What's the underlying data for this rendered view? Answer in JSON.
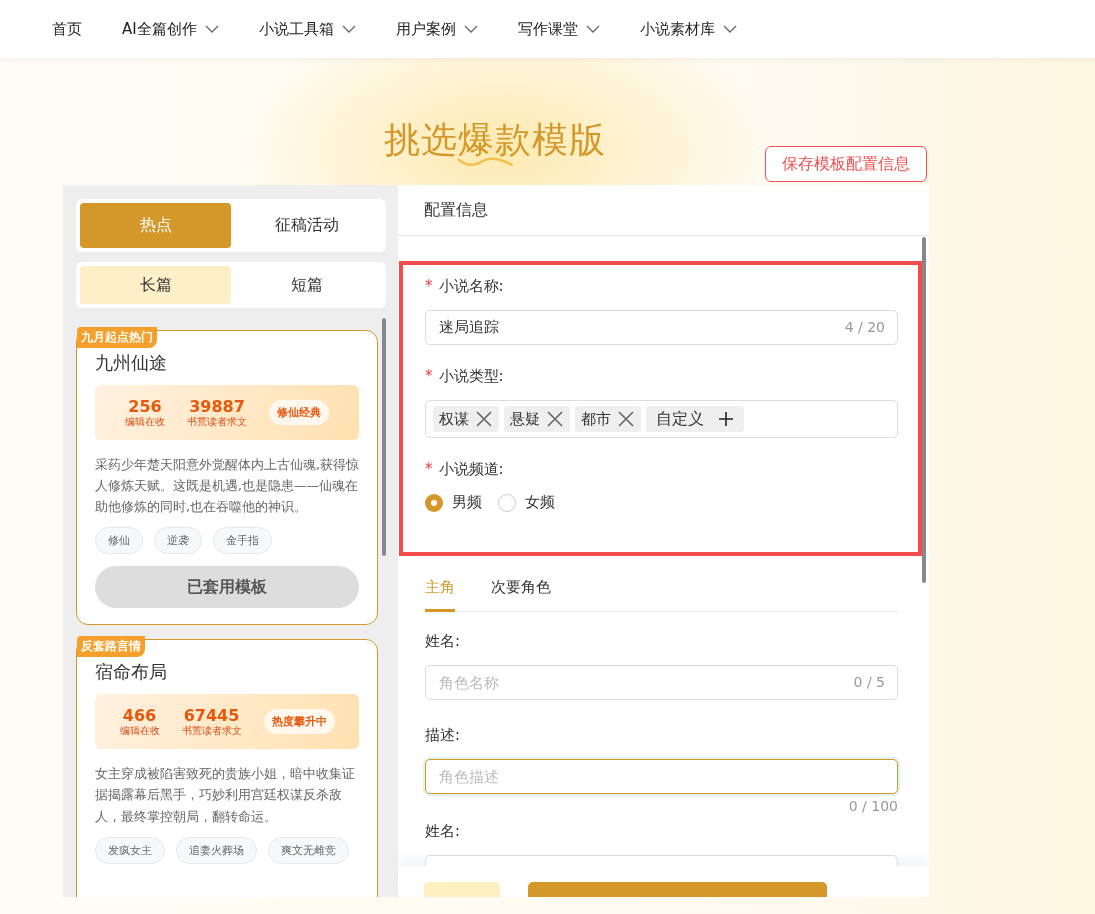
{
  "nav": [
    {
      "label": "首页",
      "dropdown": false
    },
    {
      "label": "AI全篇创作",
      "dropdown": true
    },
    {
      "label": "小说工具箱",
      "dropdown": true
    },
    {
      "label": "用户案例",
      "dropdown": true
    },
    {
      "label": "写作课堂",
      "dropdown": true
    },
    {
      "label": "小说素材库",
      "dropdown": true
    }
  ],
  "title": "挑选爆款模版",
  "save_button": "保存模板配置信息",
  "left": {
    "tabs": [
      {
        "label": "热点",
        "selected": true
      },
      {
        "label": "征稿活动",
        "selected": false
      }
    ],
    "length_tabs": [
      {
        "label": "长篇",
        "selected": true
      },
      {
        "label": "短篇",
        "selected": false
      }
    ],
    "cards": [
      {
        "badge": "九月起点热门",
        "title": "九州仙途",
        "stats": [
          {
            "value": "256",
            "label": "编辑在收"
          },
          {
            "value": "39887",
            "label": "书荒读者求文"
          }
        ],
        "highlight": "修仙经典",
        "summary": "采药少年楚天阳意外觉醒体内上古仙魂,获得惊人修炼天赋。这既是机遇,也是隐患——仙魂在助他修炼的同时,也在吞噬他的神识。",
        "tags": [
          "修仙",
          "逆袭",
          "金手指"
        ],
        "button": "已套用模板"
      },
      {
        "badge": "反套路言情",
        "title": "宿命布局",
        "stats": [
          {
            "value": "466",
            "label": "编辑在收"
          },
          {
            "value": "67445",
            "label": "书荒读者求文"
          }
        ],
        "highlight": "热度攀升中",
        "summary": "女主穿成被陷害致死的贵族小姐，暗中收集证据揭露幕后黑手，巧妙利用宫廷权谋反杀敌人，最终掌控朝局，翻转命运。",
        "tags": [
          "发疯女主",
          "追妻火葬场",
          "爽文无雌竞"
        ]
      }
    ]
  },
  "config": {
    "header": "配置信息",
    "highlighted": true,
    "fields": [
      {
        "kind": "text",
        "required_mark": "*",
        "label": "小说名称:",
        "value": "迷局追踪",
        "counter": "4 / 20"
      },
      {
        "kind": "tags",
        "required_mark": "*",
        "label": "小说类型:",
        "tags": [
          "权谋",
          "悬疑",
          "都市"
        ],
        "add_label": "自定义"
      },
      {
        "kind": "radio",
        "required_mark": "*",
        "label": "小说频道:",
        "options": [
          {
            "label": "男频",
            "selected": true
          },
          {
            "label": "女频",
            "selected": false
          }
        ]
      }
    ]
  },
  "role_tabs": [
    {
      "label": "主角",
      "selected": true
    },
    {
      "label": "次要角色",
      "selected": false
    }
  ],
  "role_fields": [
    {
      "kind": "text",
      "label": "姓名:",
      "placeholder": "角色名称",
      "counter": "0 / 5",
      "focused": false
    },
    {
      "kind": "textarea",
      "label": "描述:",
      "placeholder": "角色描述",
      "counter": "0 / 100",
      "focused": true
    },
    {
      "kind": "text",
      "label": "姓名:",
      "focused": false
    }
  ],
  "buttons": [
    {
      "kind": "secondary"
    },
    {
      "kind": "primary"
    }
  ]
}
